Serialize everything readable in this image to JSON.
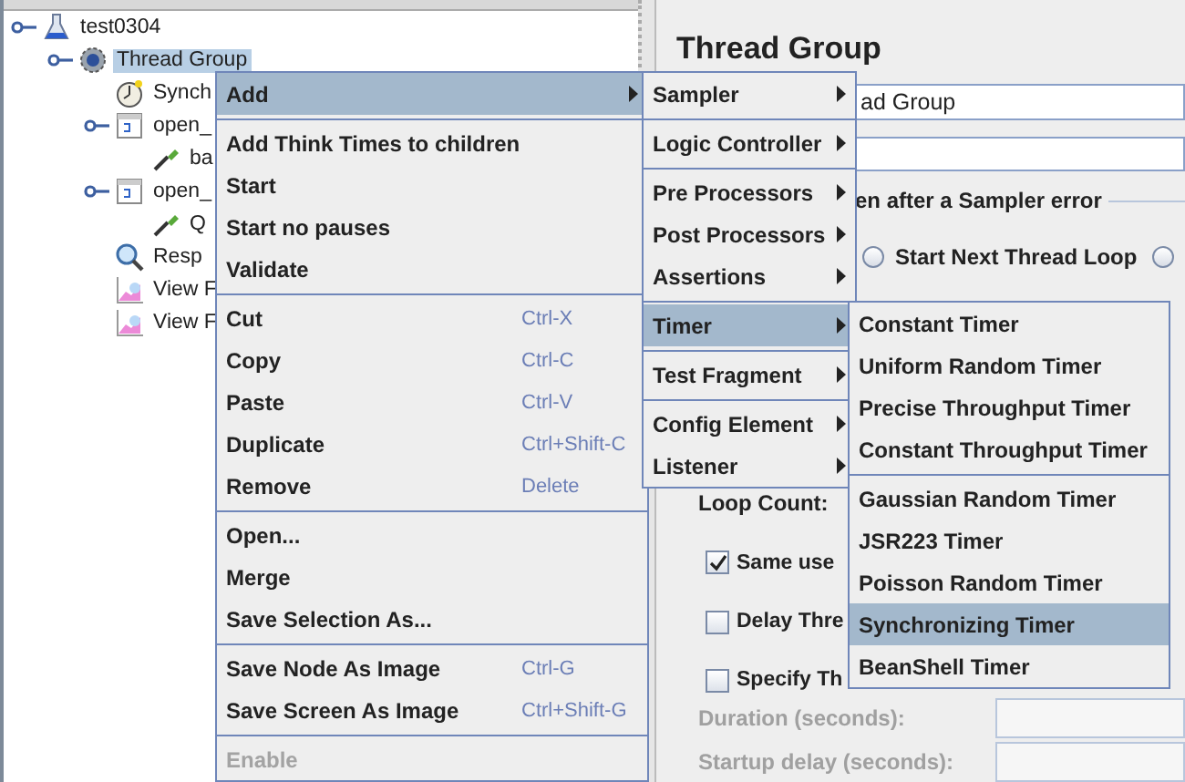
{
  "tree": [
    {
      "label": "test0304",
      "kind": "test-plan",
      "selected": false,
      "children": [
        {
          "label": "Thread Group",
          "kind": "thread-group",
          "selected": true,
          "children": [
            {
              "label": "Synch",
              "kind": "timer",
              "selected": false
            },
            {
              "label": "open_",
              "kind": "controller",
              "selected": false,
              "children": [
                {
                  "label": "ba",
                  "kind": "sampler",
                  "selected": false
                }
              ]
            },
            {
              "label": "open_",
              "kind": "controller",
              "selected": false,
              "children": [
                {
                  "label": "Q",
                  "kind": "sampler",
                  "selected": false
                }
              ]
            },
            {
              "label": "Resp",
              "kind": "results-tree",
              "selected": false
            },
            {
              "label": "View F",
              "kind": "graph",
              "selected": false
            },
            {
              "label": "View F",
              "kind": "graph",
              "selected": false
            }
          ]
        }
      ]
    }
  ],
  "panel": {
    "title": "Thread Group",
    "name_field": {
      "value": "ad Group"
    },
    "error_action": {
      "label": "en after a Sampler error",
      "options": [
        {
          "label": "Start Next Thread Loop",
          "selected": false
        },
        {
          "selected": false
        }
      ]
    },
    "loop_count_label": "Loop Count:",
    "checkboxes": [
      {
        "label": "Same use",
        "checked": true
      },
      {
        "label": "Delay Thre",
        "checked": false
      },
      {
        "label": "Specify Th",
        "checked": false
      }
    ],
    "disabled_fields": [
      {
        "label": "Duration (seconds):",
        "disabled": true
      },
      {
        "label": "Startup delay (seconds):",
        "disabled": true
      }
    ]
  },
  "main_menu": [
    {
      "kind": "item",
      "label": "Add",
      "submenu": true,
      "selected": true,
      "disabled": false
    },
    {
      "kind": "separator"
    },
    {
      "kind": "item",
      "label": "Add Think Times to children",
      "submenu": false,
      "selected": false,
      "disabled": false
    },
    {
      "kind": "item",
      "label": "Start",
      "submenu": false,
      "selected": false,
      "disabled": false
    },
    {
      "kind": "item",
      "label": "Start no pauses",
      "submenu": false,
      "selected": false,
      "disabled": false
    },
    {
      "kind": "item",
      "label": "Validate",
      "submenu": false,
      "selected": false,
      "disabled": false
    },
    {
      "kind": "separator"
    },
    {
      "kind": "item",
      "label": "Cut",
      "shortcut": "Ctrl-X",
      "submenu": false,
      "selected": false,
      "disabled": false
    },
    {
      "kind": "item",
      "label": "Copy",
      "shortcut": "Ctrl-C",
      "submenu": false,
      "selected": false,
      "disabled": false
    },
    {
      "kind": "item",
      "label": "Paste",
      "shortcut": "Ctrl-V",
      "submenu": false,
      "selected": false,
      "disabled": false
    },
    {
      "kind": "item",
      "label": "Duplicate",
      "shortcut": "Ctrl+Shift-C",
      "submenu": false,
      "selected": false,
      "disabled": false
    },
    {
      "kind": "item",
      "label": "Remove",
      "shortcut": "Delete",
      "submenu": false,
      "selected": false,
      "disabled": false
    },
    {
      "kind": "separator"
    },
    {
      "kind": "item",
      "label": "Open...",
      "submenu": false,
      "selected": false,
      "disabled": false
    },
    {
      "kind": "item",
      "label": "Merge",
      "submenu": false,
      "selected": false,
      "disabled": false
    },
    {
      "kind": "item",
      "label": "Save Selection As...",
      "submenu": false,
      "selected": false,
      "disabled": false
    },
    {
      "kind": "separator"
    },
    {
      "kind": "item",
      "label": "Save Node As Image",
      "shortcut": "Ctrl-G",
      "submenu": false,
      "selected": false,
      "disabled": false
    },
    {
      "kind": "item",
      "label": "Save Screen As Image",
      "shortcut": "Ctrl+Shift-G",
      "submenu": false,
      "selected": false,
      "disabled": false
    },
    {
      "kind": "separator"
    },
    {
      "kind": "item",
      "label": "Enable",
      "submenu": false,
      "selected": false,
      "disabled": true
    }
  ],
  "add_menu": [
    {
      "kind": "item",
      "label": "Sampler",
      "submenu": true,
      "selected": false
    },
    {
      "kind": "separator"
    },
    {
      "kind": "item",
      "label": "Logic Controller",
      "submenu": true,
      "selected": false
    },
    {
      "kind": "separator"
    },
    {
      "kind": "item",
      "label": "Pre Processors",
      "submenu": true,
      "selected": false
    },
    {
      "kind": "item",
      "label": "Post Processors",
      "submenu": true,
      "selected": false
    },
    {
      "kind": "item",
      "label": "Assertions",
      "submenu": true,
      "selected": false
    },
    {
      "kind": "separator"
    },
    {
      "kind": "item",
      "label": "Timer",
      "submenu": true,
      "selected": true
    },
    {
      "kind": "separator"
    },
    {
      "kind": "item",
      "label": "Test Fragment",
      "submenu": true,
      "selected": false
    },
    {
      "kind": "separator"
    },
    {
      "kind": "item",
      "label": "Config Element",
      "submenu": true,
      "selected": false
    },
    {
      "kind": "item",
      "label": "Listener",
      "submenu": true,
      "selected": false
    }
  ],
  "timer_menu": [
    {
      "kind": "item",
      "label": "Constant Timer",
      "selected": false
    },
    {
      "kind": "item",
      "label": "Uniform Random Timer",
      "selected": false
    },
    {
      "kind": "item",
      "label": "Precise Throughput Timer",
      "selected": false
    },
    {
      "kind": "item",
      "label": "Constant Throughput Timer",
      "selected": false
    },
    {
      "kind": "separator"
    },
    {
      "kind": "item",
      "label": "Gaussian Random Timer",
      "selected": false
    },
    {
      "kind": "item",
      "label": "JSR223 Timer",
      "selected": false
    },
    {
      "kind": "item",
      "label": "Poisson Random Timer",
      "selected": false
    },
    {
      "kind": "item",
      "label": "Synchronizing Timer",
      "selected": true
    },
    {
      "kind": "item",
      "label": "BeanShell Timer",
      "selected": false
    }
  ]
}
